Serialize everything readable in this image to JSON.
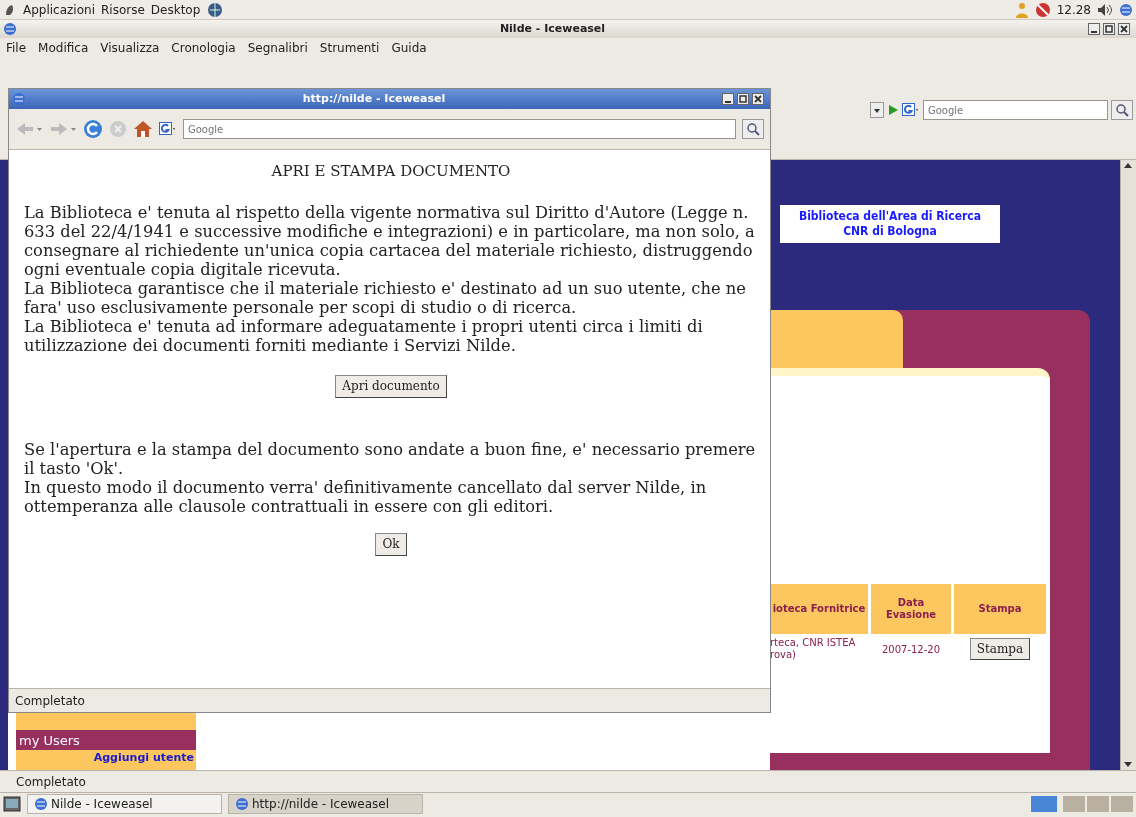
{
  "desktop_panel": {
    "menus": [
      "Applicazioni",
      "Risorse",
      "Desktop"
    ],
    "clock": "12.28"
  },
  "main_window": {
    "title": "Nilde - Iceweasel",
    "menu": [
      "File",
      "Modifica",
      "Visualizza",
      "Cronologia",
      "Segnalibri",
      "Strumenti",
      "Guida"
    ],
    "search": {
      "placeholder": "Google"
    },
    "page": {
      "logo": [
        "Biblioteca dell'Area di Ricerca",
        "CNR di Bologna"
      ],
      "table": {
        "columns": [
          "ioteca Fornitrice",
          "Data Evasione",
          "Stampa"
        ],
        "rows": [
          {
            "library": [
              "rteca, CNR ISTEA",
              "rova)"
            ],
            "date": "2007-12-20",
            "action": "Stampa"
          }
        ]
      },
      "sidebar": {
        "heading": "my Users",
        "link": "Aggiungi utente"
      }
    },
    "status": "Completato"
  },
  "popup": {
    "title": "http://nilde - Iceweasel",
    "search": {
      "placeholder": "Google"
    },
    "heading": "APRI E STAMPA DOCUMENTO",
    "paragraphs": [
      "La Biblioteca e' tenuta al rispetto della vigente normativa sul Diritto d'Autore (Legge n. 633 del 22/4/1941 e successive modifiche e integrazioni) e in particolare, ma non solo, a consegnare al richiedente un'unica copia cartacea del materiale richiesto, distruggendo ogni eventuale copia digitale ricevuta.",
      "La Biblioteca garantisce che il materiale richiesto e' destinato ad un suo utente, che ne fara' uso esclusivamente personale per scopi di studio o di ricerca.",
      "La Biblioteca e' tenuta ad informare adeguatamente i propri utenti circa i limiti di utilizzazione dei documenti forniti mediante i Servizi Nilde."
    ],
    "open_button": "Apri documento",
    "notes": [
      "Se l'apertura e la stampa del documento sono andate a buon fine, e' necessario premere il tasto 'Ok'.",
      "In questo modo il documento verra' definitivamente cancellato dal server Nilde, in ottemperanza alle clausole contrattuali in essere con gli editori."
    ],
    "ok_button": "Ok",
    "status": "Completato"
  },
  "taskbar": [
    {
      "label": "Nilde - Iceweasel",
      "selected": false
    },
    {
      "label": "http://nilde - Iceweasel",
      "selected": true
    }
  ]
}
